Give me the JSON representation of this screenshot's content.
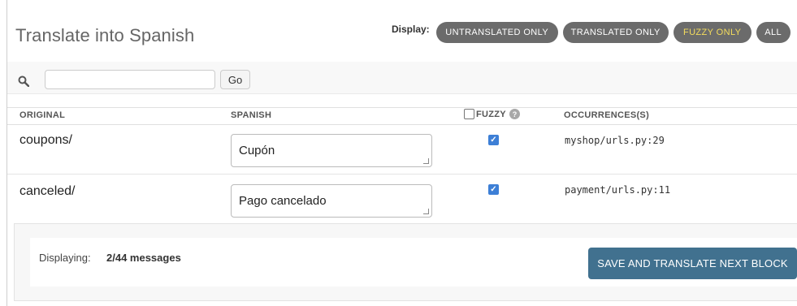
{
  "header": {
    "title": "Translate into Spanish",
    "display_label": "Display:",
    "filters": [
      {
        "label": "UNTRANSLATED ONLY",
        "key": "untranslated"
      },
      {
        "label": "TRANSLATED ONLY",
        "key": "translated"
      },
      {
        "label": "FUZZY ONLY",
        "key": "fuzzy"
      },
      {
        "label": "ALL",
        "key": "all"
      }
    ]
  },
  "search": {
    "value": "",
    "placeholder": "",
    "go_label": "Go",
    "icon": "search-icon"
  },
  "table": {
    "columns": {
      "original": "ORIGINAL",
      "translation": "SPANISH",
      "fuzzy": "FUZZY",
      "occurrences": "OCCURRENCES(S)"
    },
    "help_glyph": "?",
    "rows": [
      {
        "original": "coupons/",
        "translation": "Cupón",
        "fuzzy": true,
        "occurrences": "myshop/urls.py:29"
      },
      {
        "original": "canceled/",
        "translation": "Pago cancelado",
        "fuzzy": true,
        "occurrences": "payment/urls.py:11"
      }
    ]
  },
  "footer": {
    "displaying_label": "Displaying:",
    "displaying_value": "2/44 messages",
    "save_label": "SAVE AND TRANSLATE NEXT BLOCK"
  },
  "colors": {
    "pill_bg": "#6b6b6b",
    "fuzzy_text": "#f5dd5d",
    "save_bg": "#41718f",
    "checkbox": "#3d7fd6"
  }
}
